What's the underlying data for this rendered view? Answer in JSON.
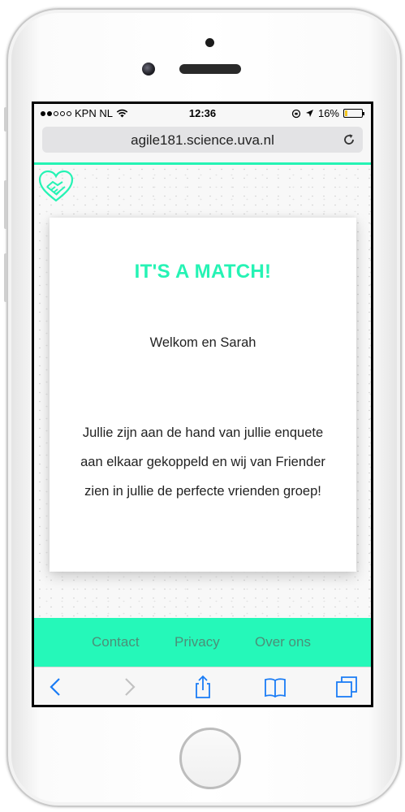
{
  "status_bar": {
    "carrier": "KPN NL",
    "time": "12:36",
    "battery_percent": "16%",
    "battery_level": 0.16,
    "battery_color": "#f3c620"
  },
  "browser": {
    "url": "agile181.science.uva.nl",
    "reload_icon": "reload-icon"
  },
  "site": {
    "logo_icon": "heart-handshake-icon",
    "accent_color": "#25f3b4"
  },
  "card": {
    "title": "IT'S A MATCH!",
    "welcome": "Welkom en Sarah",
    "message": "Jullie zijn aan de hand van jullie enquete aan elkaar gekoppeld en wij van Friender zien in jullie de perfecte vrienden groep!"
  },
  "footer": {
    "links": [
      "Contact",
      "Privacy",
      "Over ons"
    ]
  },
  "toolbar": {
    "icons": [
      "back-icon",
      "forward-icon",
      "share-icon",
      "bookmarks-icon",
      "tabs-icon"
    ]
  }
}
